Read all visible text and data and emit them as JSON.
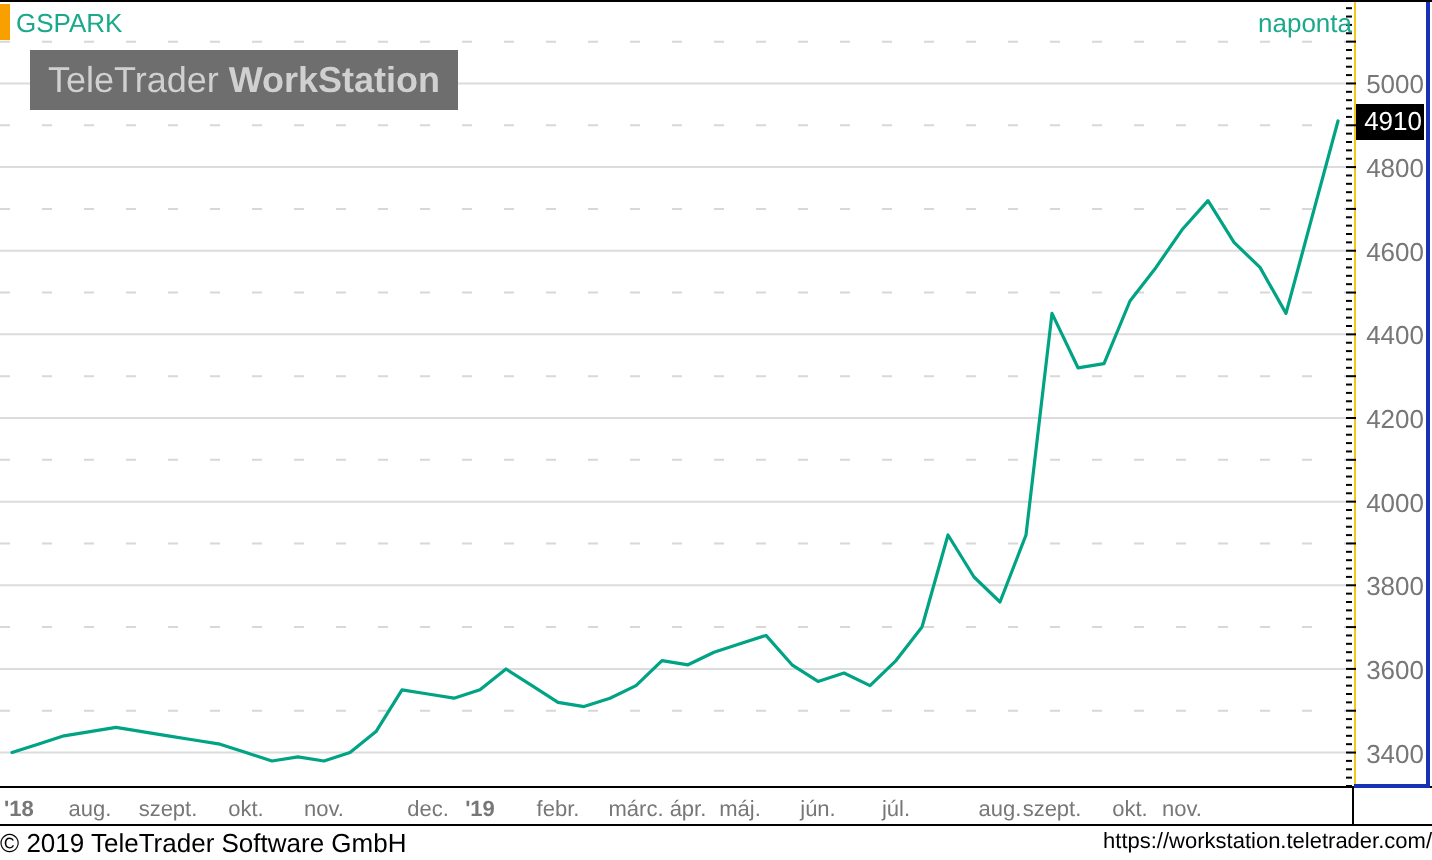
{
  "chart": {
    "symbol": "GSPARK",
    "interval": "naponta",
    "logo": "TeleTrader **WorkStation**",
    "last_price": "4910",
    "chart_data": {
      "type": "line",
      "categories": [
        "'18",
        null,
        null,
        "aug.",
        null,
        null,
        "szept.",
        null,
        null,
        "okt.",
        null,
        null,
        "nov.",
        null,
        null,
        null,
        "dec.",
        null,
        "'19",
        null,
        null,
        "febr.",
        null,
        null,
        "márc.",
        null,
        "ápr.",
        null,
        "máj.",
        null,
        null,
        "jún.",
        null,
        null,
        "júl.",
        null,
        null,
        null,
        "aug.",
        null,
        "szept.",
        null,
        null,
        "okt.",
        null,
        "nov.",
        null,
        null,
        null,
        null,
        null,
        null
      ],
      "series": [
        {
          "color": "#00a383",
          "values": [
            3400,
            3420,
            3440,
            3450,
            3460,
            3450,
            3440,
            3430,
            3420,
            3400,
            3380,
            3390,
            3380,
            3400,
            3450,
            3550,
            3540,
            3530,
            3550,
            3600,
            3560,
            3520,
            3510,
            3530,
            3560,
            3620,
            3610,
            3640,
            3660,
            3680,
            3610,
            3570,
            3590,
            3560,
            3620,
            3700,
            3920,
            3820,
            3760,
            3920,
            4450,
            4320,
            4330,
            4480,
            4560,
            4650,
            4720,
            4620,
            4560,
            4450,
            4680,
            4910
          ]
        }
      ],
      "ylim": [
        3320,
        5190
      ],
      "grid": true,
      "yticks": [
        3400,
        3600,
        3800,
        4000,
        4200,
        4400,
        4600,
        4800,
        5000
      ]
    }
  },
  "footer": {
    "copyright": "© 2019 TeleTrader Software GmbH",
    "url": "https://workstation.teletrader.com/"
  }
}
